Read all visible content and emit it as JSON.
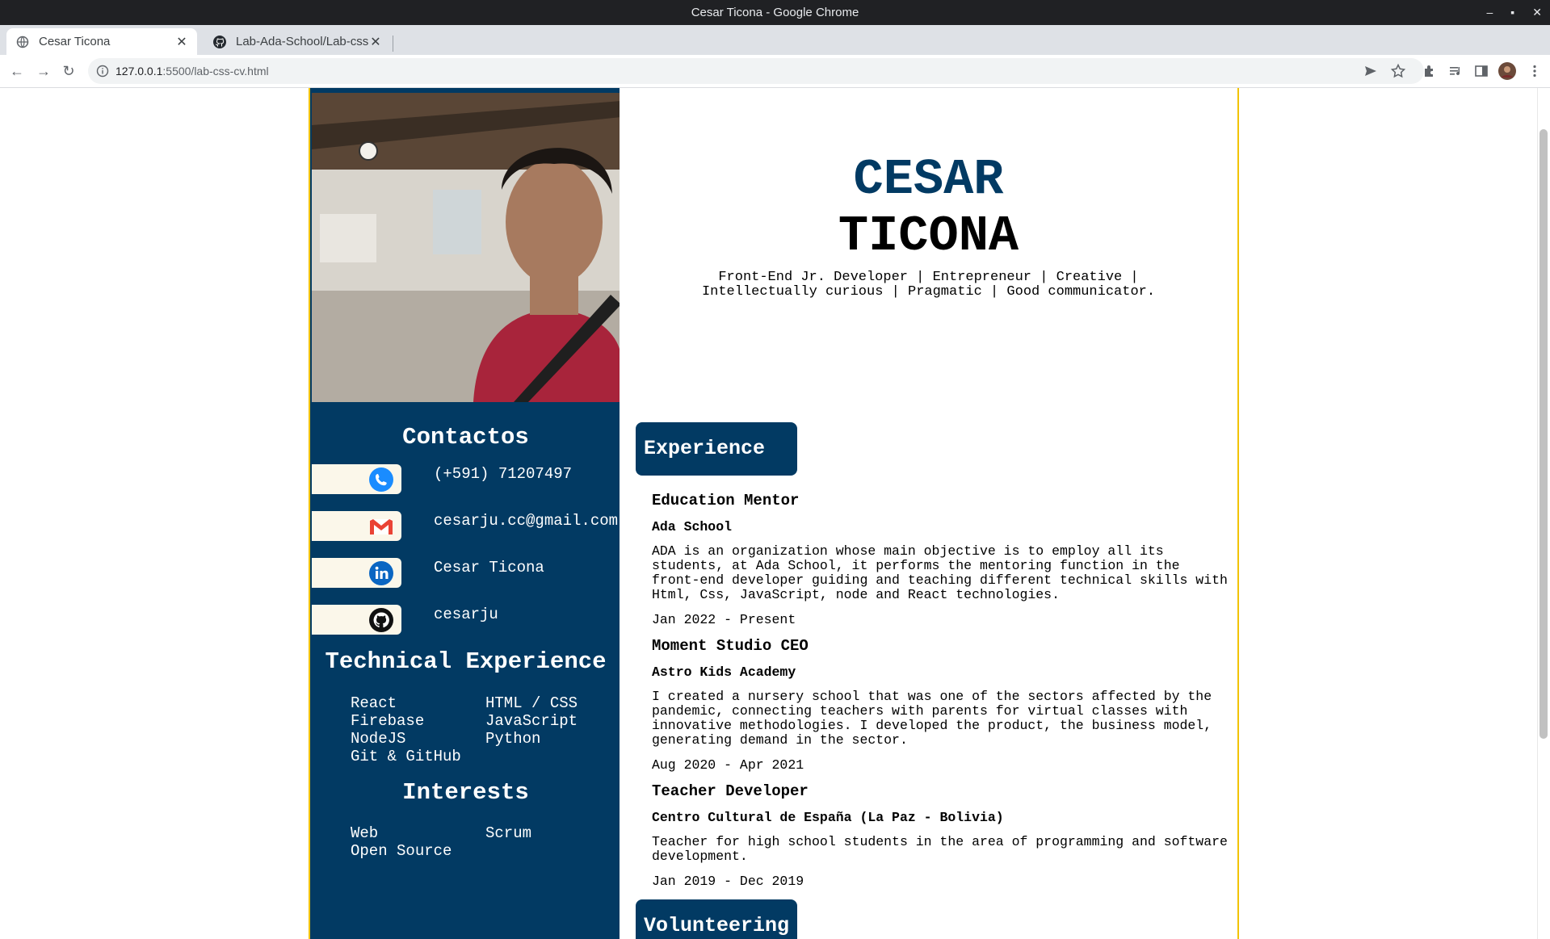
{
  "window": {
    "title": "Cesar Ticona - Google Chrome"
  },
  "tabs": [
    {
      "label": "Cesar Ticona",
      "icon": "globe-icon",
      "active": true
    },
    {
      "label": "Lab-Ada-School/Lab-css",
      "icon": "github-icon",
      "active": false
    }
  ],
  "address": {
    "host": "127.0.0.1",
    "path": ":5500/lab-css-cv.html"
  },
  "cv": {
    "name_first": "CESAR",
    "name_last": "TICONA",
    "tagline": "Front-End Jr. Developer | Entrepreneur | Creative | Intellectually curious | Pragmatic | Good communicator.",
    "contacts_title": "Contactos",
    "contacts": [
      {
        "icon": "phone-icon",
        "text": "(+591) 71207497"
      },
      {
        "icon": "gmail-icon",
        "text": "cesarju.cc@gmail.com"
      },
      {
        "icon": "linkedin-icon",
        "text": "Cesar Ticona"
      },
      {
        "icon": "github-icon",
        "text": "cesarju"
      }
    ],
    "tech_title": "Technical Experience",
    "tech_skills": [
      "React",
      "HTML / CSS",
      "Firebase",
      "JavaScript",
      "NodeJS",
      "Python",
      "Git & GitHub"
    ],
    "interests_title": "Interests",
    "interests": [
      "Web",
      "Scrum",
      "Open Source"
    ],
    "experience_title": "Experience",
    "jobs": [
      {
        "title": "Education Mentor",
        "org": "Ada School",
        "desc": "ADA is an organization whose main objective is to employ all its students, at Ada School, it performs the mentoring function in the front-end developer guiding and teaching different technical skills with Html, Css, JavaScript, node and React technologies.",
        "dates": "Jan 2022 - Present"
      },
      {
        "title": "Moment Studio CEO",
        "org": "Astro Kids Academy",
        "desc": "I created a nursery school that was one of the sectors affected by the pandemic, connecting teachers with parents for virtual classes with innovative methodologies. I developed the product, the business model, generating demand in the sector.",
        "dates": "Aug 2020 - Apr 2021"
      },
      {
        "title": "Teacher Developer",
        "org": "Centro Cultural de España (La Paz - Bolivia)",
        "desc": "Teacher for high school students in the area of programming and software development.",
        "dates": "Jan 2019 - Dec 2019"
      }
    ],
    "volunteering_title": "Volunteering"
  },
  "colors": {
    "navy": "#023a63",
    "accent_yellow": "#f2c300",
    "pill_bg": "#fbf7ea"
  }
}
